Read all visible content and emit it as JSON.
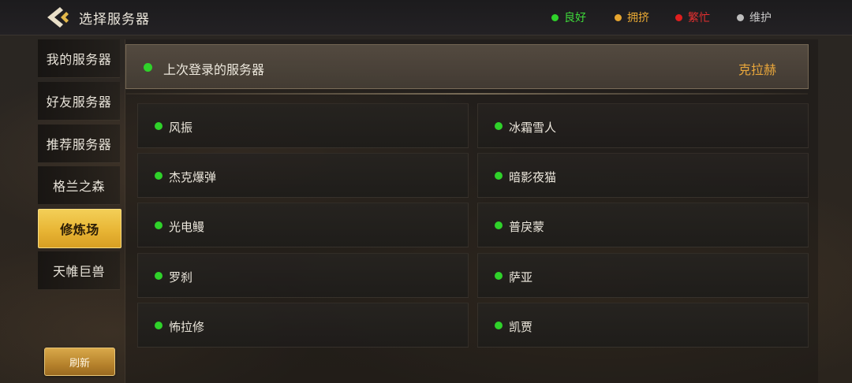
{
  "header": {
    "title": "选择服务器",
    "back_icon": "back-arrow-icon"
  },
  "legend": [
    {
      "label": "良好",
      "color": "#2fd22a",
      "text_color": "#3ed93a"
    },
    {
      "label": "拥挤",
      "color": "#e6a52f",
      "text_color": "#e8a934"
    },
    {
      "label": "繁忙",
      "color": "#e01e1e",
      "text_color": "#e53030"
    },
    {
      "label": "维护",
      "color": "#bdbdbd",
      "text_color": "#c7c7c7"
    }
  ],
  "sidebar": {
    "items": [
      {
        "label": "我的服务器",
        "active": false
      },
      {
        "label": "好友服务器",
        "active": false
      },
      {
        "label": "推荐服务器",
        "active": false
      },
      {
        "label": "格兰之森",
        "active": false
      },
      {
        "label": "修炼场",
        "active": true
      },
      {
        "label": "天帷巨兽",
        "active": false
      }
    ],
    "refresh_label": "刷新"
  },
  "last_login": {
    "label": "上次登录的服务器",
    "server": "克拉赫",
    "status_color": "#2fd22a"
  },
  "servers": [
    {
      "name": "风振",
      "status_color": "#2fd22a"
    },
    {
      "name": "冰霜雪人",
      "status_color": "#2fd22a"
    },
    {
      "name": "杰克爆弹",
      "status_color": "#2fd22a"
    },
    {
      "name": "暗影夜猫",
      "status_color": "#2fd22a"
    },
    {
      "name": "光电鳗",
      "status_color": "#2fd22a"
    },
    {
      "name": "普戾蒙",
      "status_color": "#2fd22a"
    },
    {
      "name": "罗刹",
      "status_color": "#2fd22a"
    },
    {
      "name": "萨亚",
      "status_color": "#2fd22a"
    },
    {
      "name": "怖拉修",
      "status_color": "#2fd22a"
    },
    {
      "name": "凯贾",
      "status_color": "#2fd22a"
    }
  ]
}
